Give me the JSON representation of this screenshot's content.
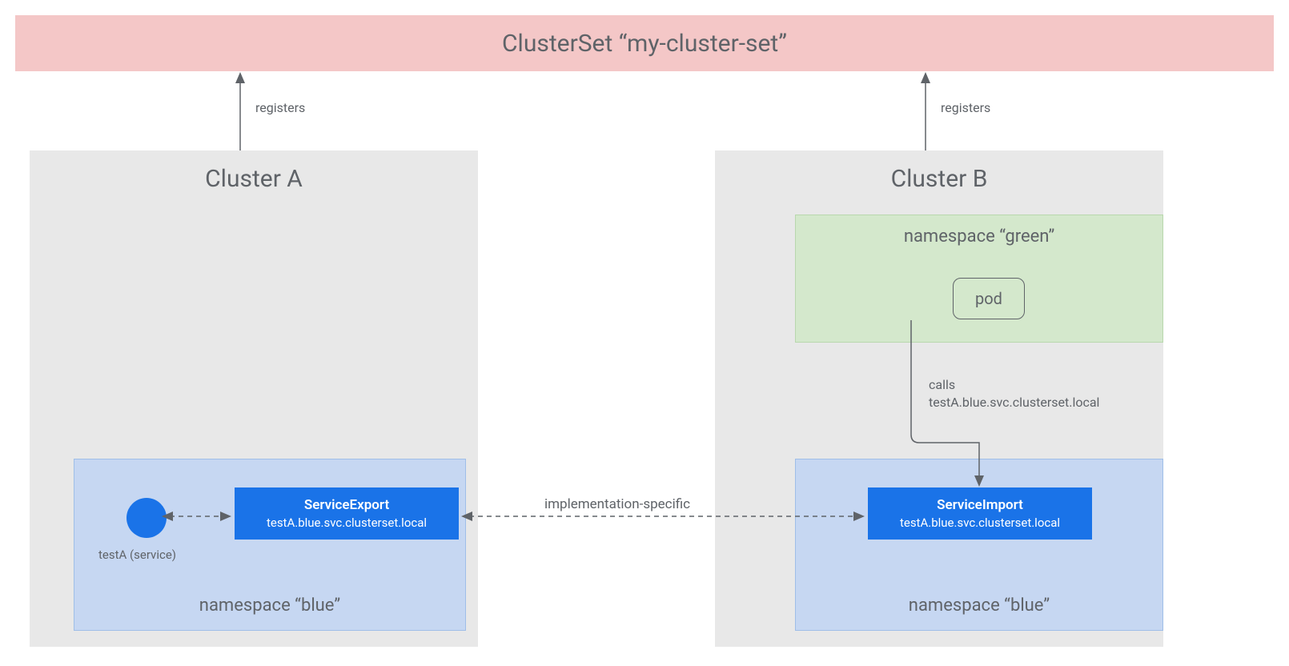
{
  "clusterset": {
    "title": "ClusterSet “my-cluster-set”"
  },
  "clusterA": {
    "title": "Cluster A",
    "namespaceBlue": {
      "label": "namespace “blue”"
    },
    "serviceExport": {
      "title": "ServiceExport",
      "domain": "testA.blue.svc.clusterset.local"
    },
    "serviceCircleLabel": "testA (service)"
  },
  "clusterB": {
    "title": "Cluster B",
    "namespaceGreen": {
      "label": "namespace “green”",
      "pod": "pod"
    },
    "namespaceBlue": {
      "label": "namespace “blue”"
    },
    "serviceImport": {
      "title": "ServiceImport",
      "domain": "testA.blue.svc.clusterset.local"
    }
  },
  "labels": {
    "registers": "registers",
    "implSpecific": "implementation-specific",
    "callsLine1": "calls",
    "callsLine2": "testA.blue.svc.clusterset.local"
  }
}
